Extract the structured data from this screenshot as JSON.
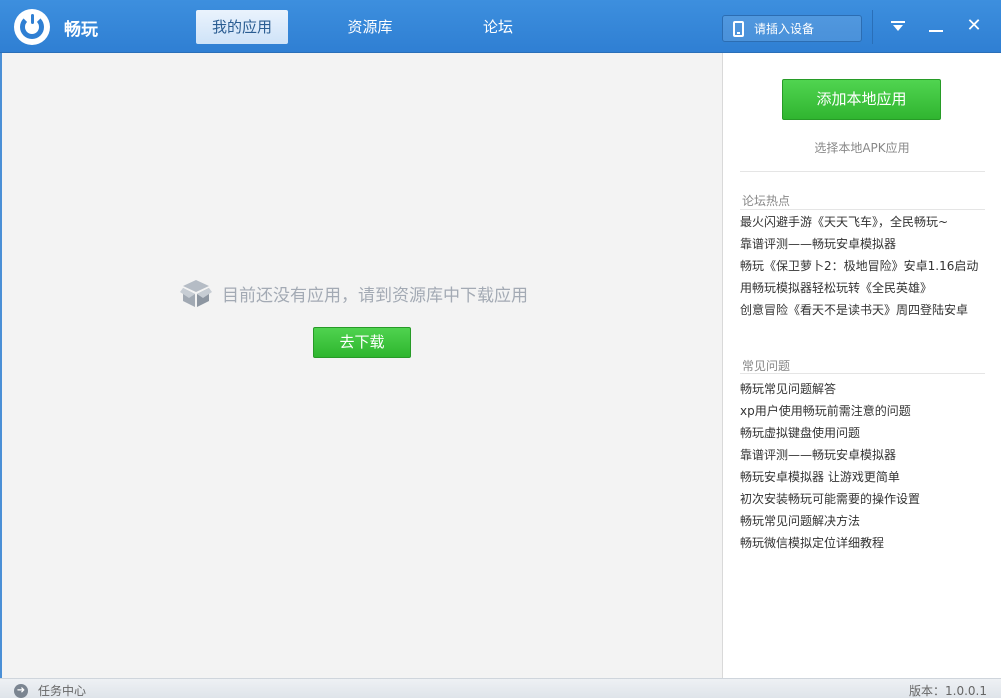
{
  "app": {
    "name": "畅玩",
    "logo_icon": "changwan-logo-icon"
  },
  "colors": {
    "titlebar": "#2f7fd3",
    "green_button": "#3cc23c",
    "muted_text": "#a3aab4"
  },
  "nav": {
    "tabs": [
      {
        "label": "我的应用",
        "active": true
      },
      {
        "label": "资源库",
        "active": false
      },
      {
        "label": "论坛",
        "active": false
      }
    ]
  },
  "device": {
    "label": "请插入设备",
    "icon": "phone-icon"
  },
  "window_controls": {
    "menu_icon": "dropdown-menu-icon",
    "min_icon": "minimize-icon",
    "close_icon": "close-icon",
    "close_glyph": "✕"
  },
  "main": {
    "empty_icon": "box-icon",
    "empty_message": "目前还没有应用，请到资源库中下载应用",
    "download_button": "去下载"
  },
  "side": {
    "add_button": "添加本地应用",
    "add_hint": "选择本地APK应用",
    "forum": {
      "title": "论坛热点",
      "items": [
        "最火闪避手游《天天飞车》，全民畅玩~",
        "靠谱评测——畅玩安卓模拟器",
        "畅玩《保卫萝卜2：极地冒险》安卓1.16启动",
        "用畅玩模拟器轻松玩转《全民英雄》",
        "创意冒险《看天不是读书天》周四登陆安卓"
      ]
    },
    "faq": {
      "title": "常见问题",
      "items": [
        "畅玩常见问题解答",
        "xp用户使用畅玩前需注意的问题",
        "畅玩虚拟键盘使用问题",
        "靠谱评测——畅玩安卓模拟器",
        "畅玩安卓模拟器 让游戏更简单",
        "初次安装畅玩可能需要的操作设置",
        "畅玩常见问题解决方法",
        "畅玩微信模拟定位详细教程"
      ]
    }
  },
  "status": {
    "task_icon": "arrow-right-icon",
    "task_label": "任务中心",
    "version": "版本：1.0.0.1"
  }
}
